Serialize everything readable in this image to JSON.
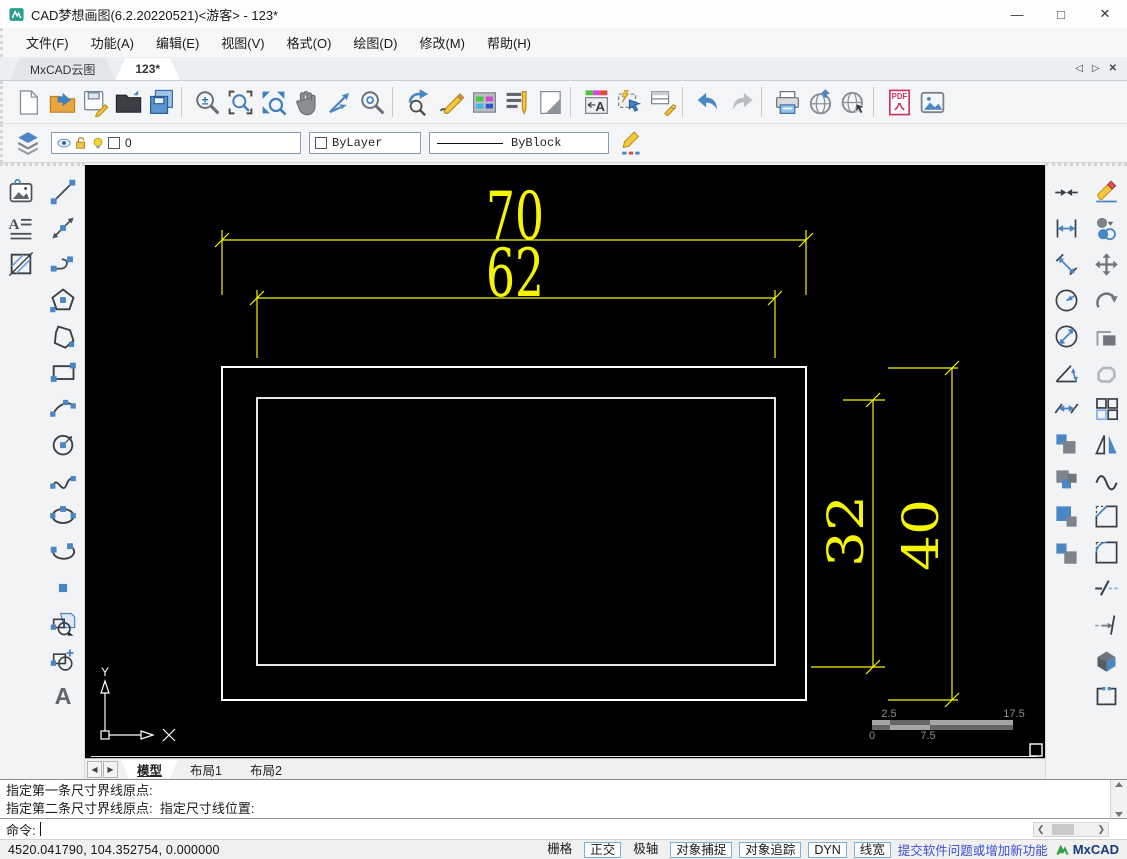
{
  "window": {
    "title": "CAD梦想画图(6.2.20220521)<游客> - 123*",
    "minimize": "—",
    "maximize": "□",
    "close": "✕"
  },
  "menu": {
    "items": [
      "文件(F)",
      "功能(A)",
      "编辑(E)",
      "视图(V)",
      "格式(O)",
      "绘图(D)",
      "修改(M)",
      "帮助(H)"
    ]
  },
  "doc_tabs": {
    "tabs": [
      {
        "label": "MxCAD云图",
        "active": false
      },
      {
        "label": "123*",
        "active": true
      }
    ],
    "nav_left": "◁",
    "nav_right": "▷",
    "close": "✕"
  },
  "toolbar_main": {
    "icons": [
      "new-file",
      "open-file",
      "save",
      "open-dark",
      "save-all",
      "sep",
      "zoom-inout",
      "zoom-window",
      "zoom-extents",
      "pan",
      "ucs-axes",
      "zoom-center",
      "sep",
      "zoom-previous",
      "sketch",
      "palette",
      "mtext-edit",
      "new-layout",
      "sep",
      "text-style",
      "quick-select",
      "match-prop",
      "sep",
      "undo",
      "redo",
      "sep",
      "print",
      "publish",
      "web",
      "sep",
      "pdf",
      "image-out"
    ]
  },
  "properties_bar": {
    "layer": {
      "value": "0"
    },
    "color": {
      "value": "ByLayer"
    },
    "linetype": {
      "value": "ByBlock"
    }
  },
  "left_toolbar": {
    "col1": [
      "insert-image",
      "mtext",
      "hatch"
    ],
    "col2": [
      "line",
      "xline",
      "polyline",
      "polygon",
      "closed-pline",
      "rectangle",
      "arc",
      "circle",
      "spline",
      "ellipse",
      "ellipse-arc",
      "point",
      "insert-block",
      "make-block",
      "text"
    ]
  },
  "right_toolbar": {
    "dim_col": [
      "dim-converge",
      "dim-linear",
      "dim-aligned",
      "dim-radius",
      "dim-diameter",
      "dim-angular",
      "dim-continue",
      "dim-style-a",
      "dim-style-b",
      "dim-style-c",
      "dim-style-d"
    ],
    "modify_col": [
      "erase",
      "copy",
      "move",
      "rotate",
      "offset",
      "pedit",
      "array",
      "mirror",
      "spline-fit",
      "chamfer",
      "fillet",
      "break",
      "extend",
      "explode",
      "group"
    ]
  },
  "canvas": {
    "dims": {
      "top": "70",
      "second": "62",
      "inner": "32",
      "outer": "40"
    },
    "scale_bar": {
      "top_left": "2.5",
      "top_right": "17.5",
      "bottom_left": "0",
      "bottom_mid": "7.5"
    },
    "ucs_y_label": "Y"
  },
  "layout_tabs": {
    "nav_left": "◀",
    "nav_right": "▶",
    "tabs": [
      {
        "label": "模型",
        "active": true
      },
      {
        "label": "布局1",
        "active": false
      },
      {
        "label": "布局2",
        "active": false
      }
    ]
  },
  "command": {
    "history": [
      "指定第一条尺寸界线原点:",
      "指定第二条尺寸界线原点:  指定尺寸线位置:"
    ],
    "prompt": "命令:"
  },
  "status_bar": {
    "coordinates": "4520.041790,  104.352754,  0.000000",
    "toggles": [
      {
        "label": "栅格",
        "boxed": false
      },
      {
        "label": "正交",
        "boxed": true
      },
      {
        "label": "极轴",
        "boxed": false
      },
      {
        "label": "对象捕捉",
        "boxed": true
      },
      {
        "label": "对象追踪",
        "boxed": true
      },
      {
        "label": "DYN",
        "boxed": true
      },
      {
        "label": "线宽",
        "boxed": true
      }
    ],
    "link": "提交软件问题或增加新功能",
    "brand": "MxCAD"
  },
  "colors": {
    "dim_yellow": "#f5f500",
    "entity_white": "#ffffff",
    "canvas_black": "#000000",
    "accent_blue": "#4a86c4"
  }
}
